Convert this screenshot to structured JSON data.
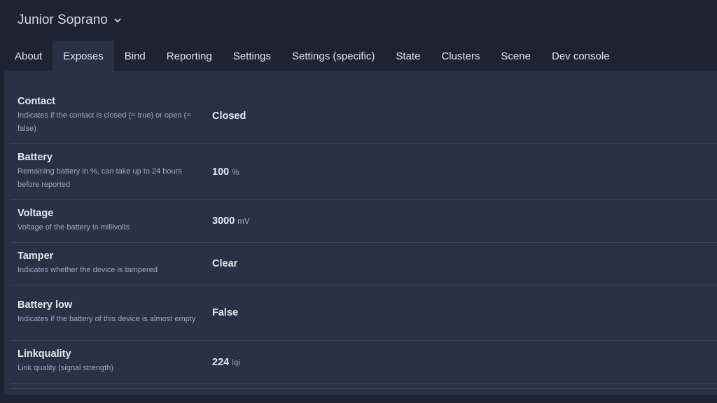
{
  "header": {
    "device_name": "Junior Soprano"
  },
  "tabs": [
    {
      "label": "About"
    },
    {
      "label": "Exposes"
    },
    {
      "label": "Bind"
    },
    {
      "label": "Reporting"
    },
    {
      "label": "Settings"
    },
    {
      "label": "Settings (specific)"
    },
    {
      "label": "State"
    },
    {
      "label": "Clusters"
    },
    {
      "label": "Scene"
    },
    {
      "label": "Dev console"
    }
  ],
  "active_tab": "Exposes",
  "exposes": [
    {
      "name": "Contact",
      "description": "Indicates if the contact is closed (= true) or open (= false)",
      "value": "Closed",
      "unit": ""
    },
    {
      "name": "Battery",
      "description": "Remaining battery in %, can take up to 24 hours before reported",
      "value": "100",
      "unit": "%"
    },
    {
      "name": "Voltage",
      "description": "Voltage of the battery in millivolts",
      "value": "3000",
      "unit": "mV"
    },
    {
      "name": "Tamper",
      "description": "Indicates whether the device is tampered",
      "value": "Clear",
      "unit": ""
    },
    {
      "name": "Battery low",
      "description": "Indicates if the battery of this device is almost empty",
      "value": "False",
      "unit": ""
    },
    {
      "name": "Linkquality",
      "description": "Link quality (signal strength)",
      "value": "224",
      "unit": "lqi"
    }
  ]
}
